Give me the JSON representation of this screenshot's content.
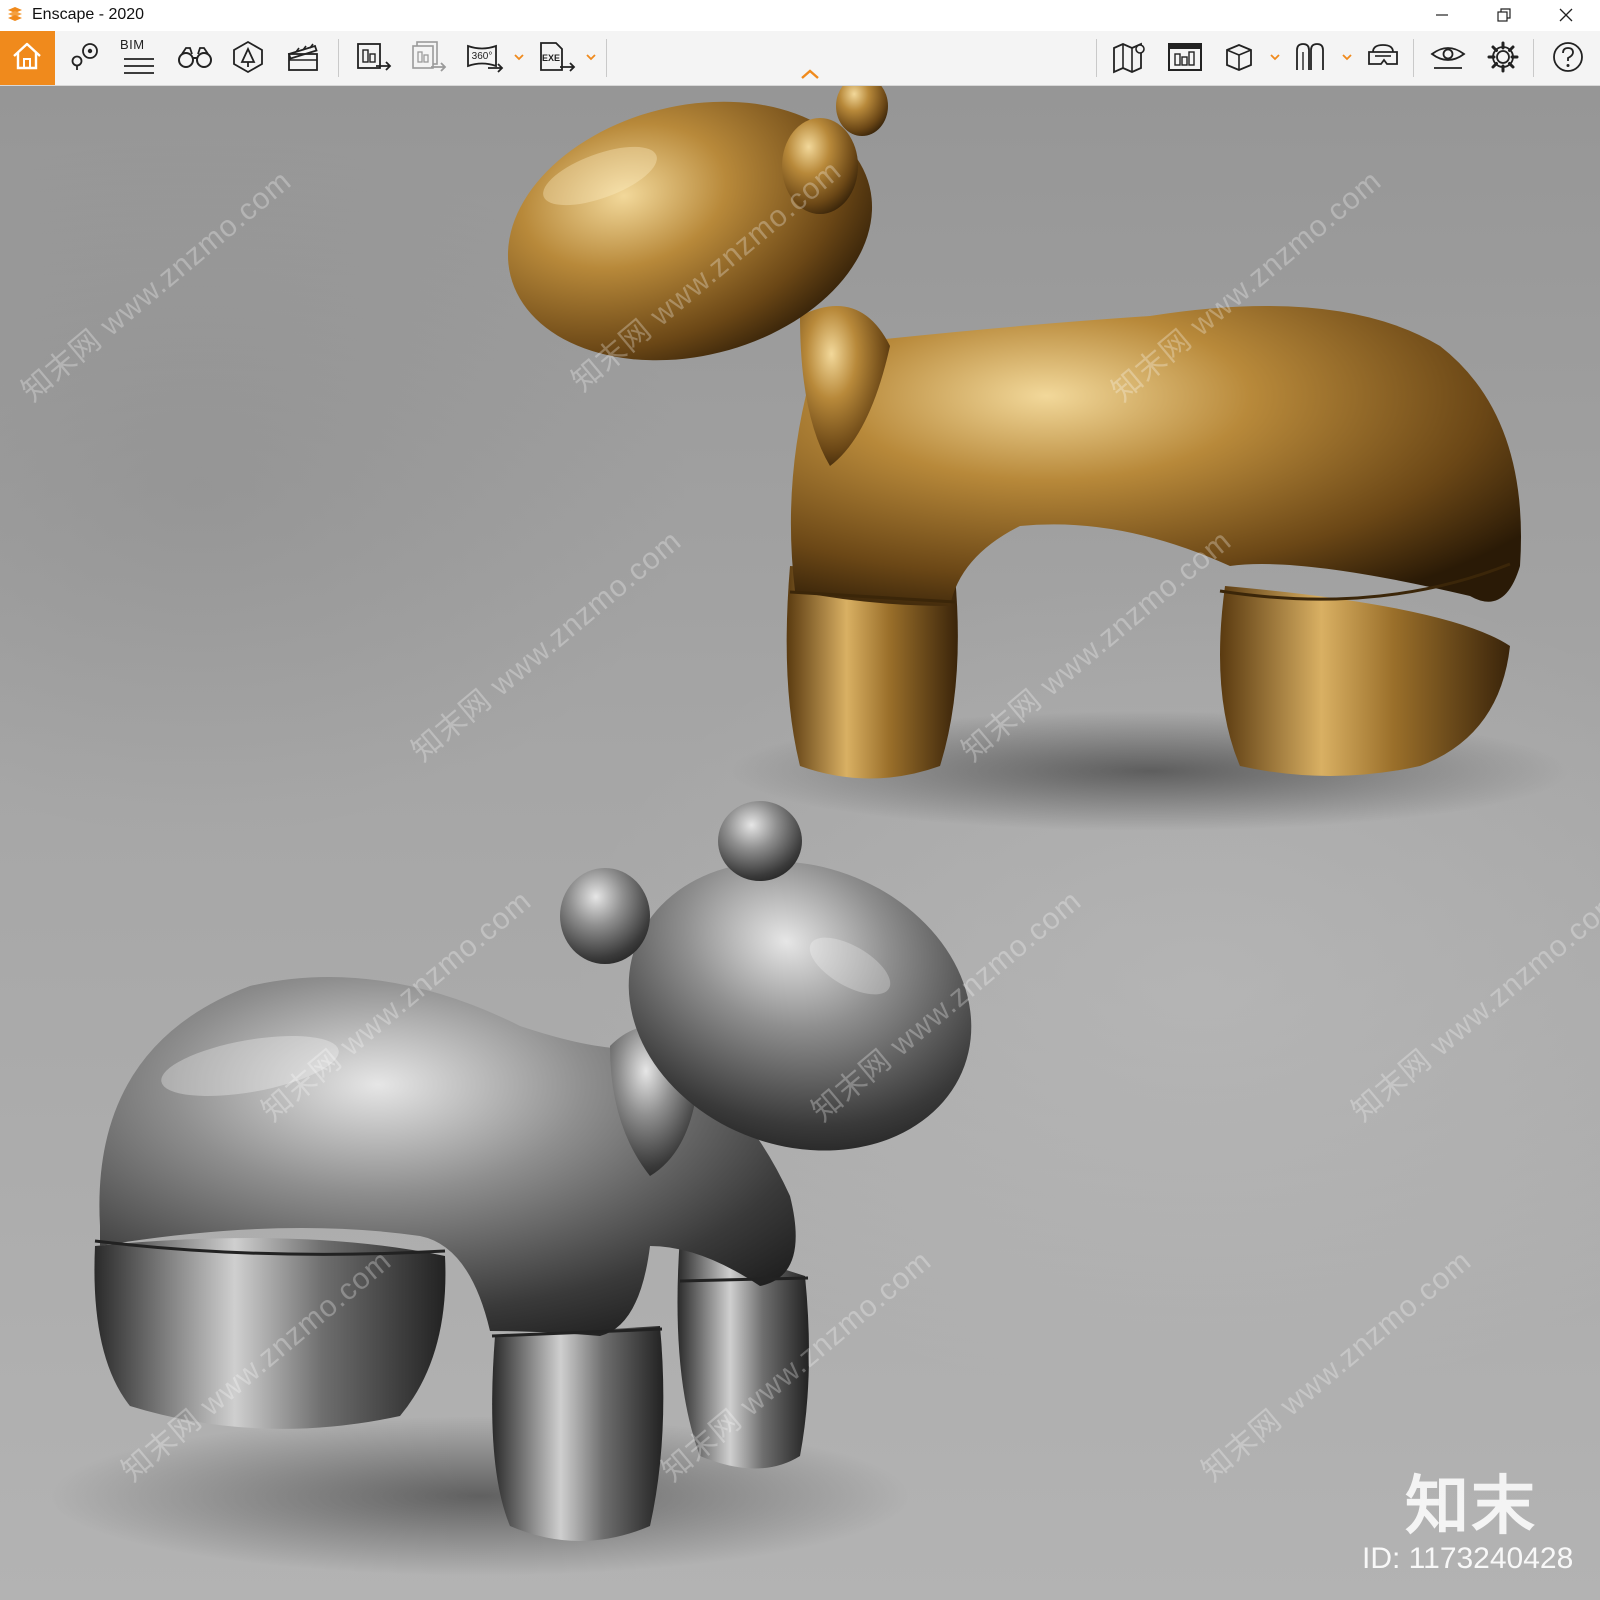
{
  "window": {
    "title": "Enscape - 2020",
    "controls": [
      "minimize",
      "restore",
      "close"
    ]
  },
  "toolbar": {
    "accent_color": "#f08a1c",
    "bim_label": "BIM",
    "buttons": [
      {
        "name": "home",
        "icon": "home-icon",
        "active": true
      },
      {
        "name": "views",
        "icon": "map-pin-icon"
      },
      {
        "name": "bim",
        "icon": "bim-list-icon"
      },
      {
        "name": "walk-fly",
        "icon": "binoculars-icon"
      },
      {
        "name": "asset-library",
        "icon": "asset-library-icon"
      },
      {
        "name": "video-editor",
        "icon": "clapperboard-icon"
      },
      {
        "name": "screenshot",
        "icon": "screenshot-export-icon"
      },
      {
        "name": "batch-render",
        "icon": "batch-render-icon"
      },
      {
        "name": "panorama-360",
        "icon": "panorama-360-icon",
        "text": "360°"
      },
      {
        "name": "exe-export",
        "icon": "exe-export-icon",
        "text": "EXE"
      },
      {
        "name": "map",
        "icon": "map-icon"
      },
      {
        "name": "render-preview",
        "icon": "render-preview-icon"
      },
      {
        "name": "view-box",
        "icon": "cube-icon"
      },
      {
        "name": "section",
        "icon": "section-icon"
      },
      {
        "name": "vr",
        "icon": "vr-headset-icon"
      },
      {
        "name": "visual-settings",
        "icon": "eye-icon"
      },
      {
        "name": "settings",
        "icon": "gear-icon"
      },
      {
        "name": "help",
        "icon": "help-icon"
      }
    ]
  },
  "viewport": {
    "scene_objects": [
      "gold-horse-sculpture",
      "silver-horse-sculpture"
    ],
    "gold_color": "#b8893a",
    "silver_color": "#8a8a8a",
    "floor_color": "#a4a4a4",
    "watermark_text": "知末网 www.znzmo.com",
    "brand_mark": "知末",
    "image_id": "ID: 1173240428"
  }
}
